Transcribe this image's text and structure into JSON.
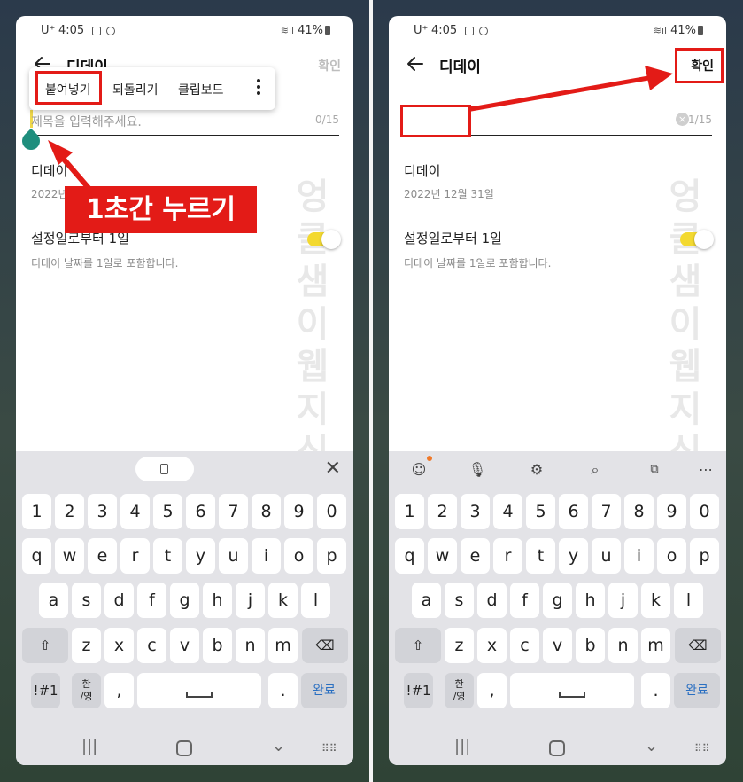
{
  "left": {
    "status": {
      "carrier": "U⁺",
      "time": "4:05",
      "signal": "41%"
    },
    "title": "디데이",
    "confirm_label": "확인",
    "context_menu": {
      "paste": "붙여넣기",
      "undo": "되돌리기",
      "clipboard": "클립보드"
    },
    "title_placeholder": "제목을 입력해주세요.",
    "counter": "0/15",
    "row1_label": "디데이",
    "row1_sub": "2022년",
    "row2_label": "설정일로부터 1일",
    "row2_sub": "디데이 날짜를 1일로 포함합니다.",
    "callout": "1초간 누르기"
  },
  "right": {
    "status": {
      "carrier": "U⁺",
      "time": "4:05",
      "signal": "41%"
    },
    "title": "디데이",
    "confirm_label": "확인",
    "counter": "1/15",
    "clear_symbol": "×",
    "row1_label": "디데이",
    "row1_sub": "2022년 12월 31일",
    "row2_label": "설정일로부터 1일",
    "row2_sub": "디데이 날짜를 1일로 포함합니다."
  },
  "watermark": "엉클샘이웹지식다",
  "keyboard": {
    "numbers": [
      "1",
      "2",
      "3",
      "4",
      "5",
      "6",
      "7",
      "8",
      "9",
      "0"
    ],
    "row1": [
      "q",
      "w",
      "e",
      "r",
      "t",
      "y",
      "u",
      "i",
      "o",
      "p"
    ],
    "row2": [
      "a",
      "s",
      "d",
      "f",
      "g",
      "h",
      "j",
      "k",
      "l"
    ],
    "row3": [
      "z",
      "x",
      "c",
      "v",
      "b",
      "n",
      "m"
    ],
    "symbols": "!#1",
    "lang_top": "한",
    "lang_bottom": "/영",
    "comma": ",",
    "period": ".",
    "done": "완료",
    "shift_symbol": "⇧",
    "backspace_symbol": "⌫",
    "close_symbol": "✕"
  },
  "toolbar_icons": [
    "emoji-icon",
    "mic-icon",
    "settings-icon",
    "search-icon",
    "translate-icon",
    "more-icon"
  ],
  "colors": {
    "highlight_red": "#e31b17",
    "toggle_yellow": "#f3d930",
    "handle_teal": "#1f8e7d",
    "done_blue": "#2a6fc1"
  }
}
